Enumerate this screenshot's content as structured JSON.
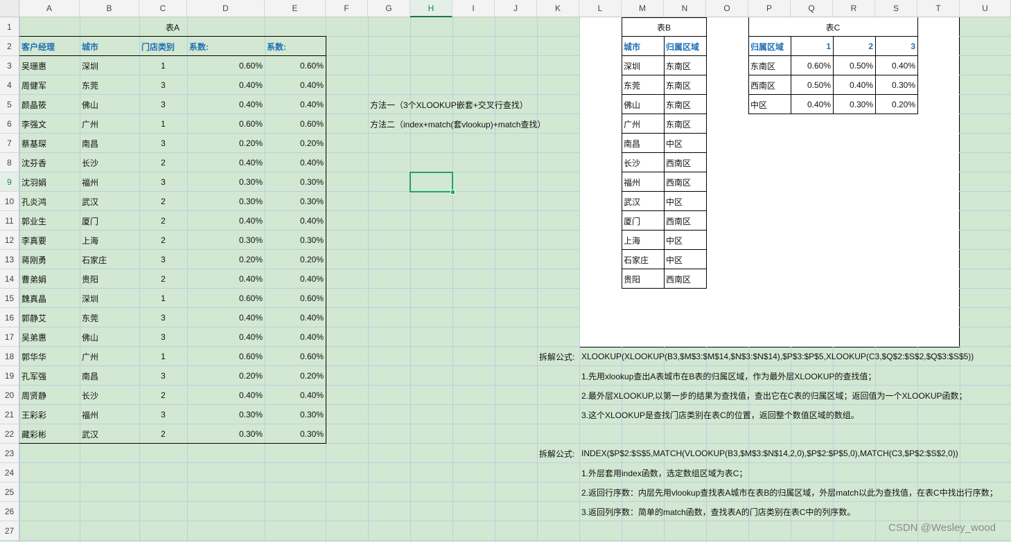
{
  "columns": [
    "A",
    "B",
    "C",
    "D",
    "E",
    "F",
    "G",
    "H",
    "I",
    "J",
    "K",
    "L",
    "M",
    "N",
    "O",
    "P",
    "Q",
    "R",
    "S",
    "T",
    "U"
  ],
  "selected_column": "H",
  "selected_row": 9,
  "table_a": {
    "title": "表A",
    "headers": [
      "客户经理",
      "城市",
      "门店类别",
      "系数:",
      "系数:"
    ],
    "rows": [
      [
        "吴珊惠",
        "深圳",
        "1",
        "0.60%",
        "0.60%"
      ],
      [
        "周健军",
        "东莞",
        "3",
        "0.40%",
        "0.40%"
      ],
      [
        "颜晶筱",
        "佛山",
        "3",
        "0.40%",
        "0.40%"
      ],
      [
        "李强文",
        "广州",
        "1",
        "0.60%",
        "0.60%"
      ],
      [
        "蔡基琛",
        "南昌",
        "3",
        "0.20%",
        "0.20%"
      ],
      [
        "沈芬香",
        "长沙",
        "2",
        "0.40%",
        "0.40%"
      ],
      [
        "沈羽娟",
        "福州",
        "3",
        "0.30%",
        "0.30%"
      ],
      [
        "孔炎鸿",
        "武汉",
        "2",
        "0.30%",
        "0.30%"
      ],
      [
        "郭业生",
        "厦门",
        "2",
        "0.40%",
        "0.40%"
      ],
      [
        "李真要",
        "上海",
        "2",
        "0.30%",
        "0.30%"
      ],
      [
        "蒋刚勇",
        "石家庄",
        "3",
        "0.20%",
        "0.20%"
      ],
      [
        "曹弟娟",
        "贵阳",
        "2",
        "0.40%",
        "0.40%"
      ],
      [
        "魏真晶",
        "深圳",
        "1",
        "0.60%",
        "0.60%"
      ],
      [
        "郭静艾",
        "东莞",
        "3",
        "0.40%",
        "0.40%"
      ],
      [
        "吴弟惠",
        "佛山",
        "3",
        "0.40%",
        "0.40%"
      ],
      [
        "郭华华",
        "广州",
        "1",
        "0.60%",
        "0.60%"
      ],
      [
        "孔军强",
        "南昌",
        "3",
        "0.20%",
        "0.20%"
      ],
      [
        "周贤静",
        "长沙",
        "2",
        "0.40%",
        "0.40%"
      ],
      [
        "王彩彩",
        "福州",
        "3",
        "0.30%",
        "0.30%"
      ],
      [
        "藏彩彬",
        "武汉",
        "2",
        "0.30%",
        "0.30%"
      ]
    ]
  },
  "table_b": {
    "title": "表B",
    "headers": [
      "城市",
      "归属区域"
    ],
    "rows": [
      [
        "深圳",
        "东南区"
      ],
      [
        "东莞",
        "东南区"
      ],
      [
        "佛山",
        "东南区"
      ],
      [
        "广州",
        "东南区"
      ],
      [
        "南昌",
        "中区"
      ],
      [
        "长沙",
        "西南区"
      ],
      [
        "福州",
        "西南区"
      ],
      [
        "武汉",
        "中区"
      ],
      [
        "厦门",
        "西南区"
      ],
      [
        "上海",
        "中区"
      ],
      [
        "石家庄",
        "中区"
      ],
      [
        "贵阳",
        "西南区"
      ]
    ]
  },
  "table_c": {
    "title": "表C",
    "headers": [
      "归属区域",
      "1",
      "2",
      "3"
    ],
    "rows": [
      [
        "东南区",
        "0.60%",
        "0.50%",
        "0.40%"
      ],
      [
        "西南区",
        "0.50%",
        "0.40%",
        "0.30%"
      ],
      [
        "中区",
        "0.40%",
        "0.30%",
        "0.20%"
      ]
    ]
  },
  "methods": {
    "method1": "方法一（3个XLOOKUP嵌套+交叉行查找）",
    "method2": "方法二（index+match(套vlookup)+match查找）"
  },
  "explain1": {
    "label": "拆解公式:",
    "formula": "XLOOKUP(XLOOKUP(B3,$M$3:$M$14,$N$3:$N$14),$P$3:$P$5,XLOOKUP(C3,$Q$2:$S$2,$Q$3:$S$5))",
    "steps": [
      "1.先用xlookup查出A表城市在B表的归属区域，作为最外层XLOOKUP的查找值；",
      "2.最外层XLOOKUP,以第一步的结果为查找值，查出它在C表的归属区域；返回值为一个XLOOKUP函数；",
      "3.这个XLOOKUP是查找门店类别在表C的位置，返回整个数值区域的数组。"
    ]
  },
  "explain2": {
    "label": "拆解公式:",
    "formula": "INDEX($P$2:$S$5,MATCH(VLOOKUP(B3,$M$3:$N$14,2,0),$P$2:$P$5,0),MATCH(C3,$P$2:$S$2,0))",
    "steps": [
      "1.外层套用index函数，选定数组区域为表C；",
      "2.返回行序数：内层先用vlookup查找表A城市在表B的归属区域，外层match以此为查找值，在表C中找出行序数；",
      "3.返回列序数：简单的match函数，查找表A的门店类别在表C中的列序数。"
    ]
  },
  "watermark": "CSDN @Wesley_wood",
  "colors": {
    "header_blue": "#1f6fb5",
    "sheet_bg": "#d2e8d2",
    "selection": "#21a366"
  }
}
